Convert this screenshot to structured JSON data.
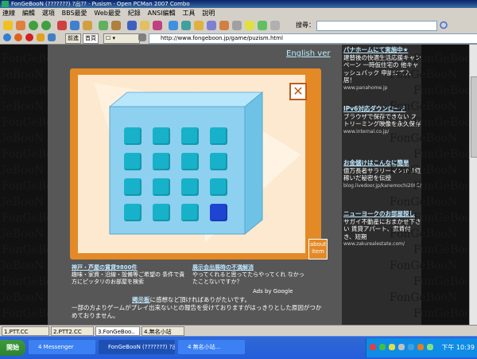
{
  "window": {
    "title": "FonGeBooN (???????) ?出?? · Pusism · Open PCMan 2007 Combo"
  },
  "menu": [
    "連線",
    "編輯",
    "選項",
    "BBS最愛",
    "Web最愛",
    "紀錄",
    "ANSI編輯",
    "工具",
    "說明"
  ],
  "toolbar": {
    "search_label": "搜尋：",
    "search_value": ""
  },
  "address": {
    "prev_label": "前進",
    "mode_label": "首頁",
    "url": "http://www.fongeboon.jp/game/puzism.html"
  },
  "colors": {
    "page_bg": "#3a3a3a",
    "frame": "#e38a27",
    "cube": "#8ed0ef",
    "button": "#17b2c9",
    "button_active": "#1e45d2",
    "link": "#bfe8ff"
  },
  "page": {
    "english_link": "English ver",
    "watermark": "FonGeBooN",
    "close_icon": "close-icon",
    "about_label": "about item",
    "ad1": {
      "title": "神戸・芦屋の賃貸9800件",
      "body": "趣味・家資・沿線・設備等ご希望の 条件で貴方にピッタリのお部屋を検索"
    },
    "ad2": {
      "title": "展示会出展時の不満解消",
      "body": "やってくれると思ってたらやってくれ なかったことないですか？"
    },
    "ads_by": "Ads by Google",
    "board_link": "掲示板",
    "board_text": "に感想など頂ければありがたいです。",
    "bottom_text": "一部の方よりゲームがプレイ出来ないとの報告を受けておりますがはっきりとした原因がつかめておりません。"
  },
  "right_ads": [
    {
      "title": "パナホームにて実施中★",
      "body": "建替後の快適生活応援キャンペーン 一時仮住宅の 他キャッシュバック 申請にて入居！",
      "url": "www.panahome.jp"
    },
    {
      "title": "IPv6対応ダウンロード",
      "body": "ブラウザで保存できない ストリーミング映像を永久保存",
      "url": "www.internal.co.jp/"
    },
    {
      "title": "お金儲けはこんなに簡単",
      "body": "億万長者サラリーマンが 1億稼いだ秘密を伝授",
      "url": "blog.livedoor.jp/kanemochi2005/"
    },
    {
      "title": "ニューヨークのお部屋探し",
      "body": "サガイ不動産におまかせ下さい 賃貸アパート、家賃付き、短期",
      "url": "www.zakurealestate.com/"
    }
  ],
  "tabs": [
    "1.PTT.CC",
    "2.PTT2.CC",
    "3.FonGeBoo..",
    "4.無名小站"
  ],
  "taskbar": {
    "start": "開始",
    "tasks": [
      "4 Messenger",
      "FonGeBooN (???????) ?出...",
      "4 無名小站..."
    ],
    "clock": "下午 10:39"
  }
}
